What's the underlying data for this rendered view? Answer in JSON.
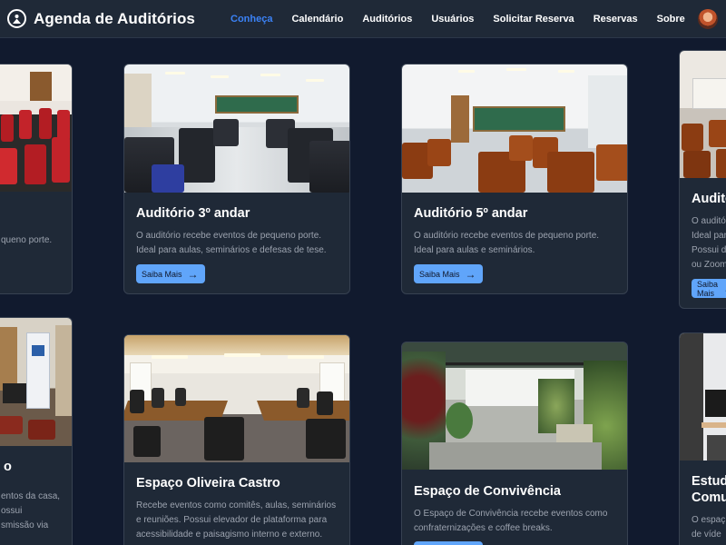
{
  "brand": {
    "title": "Agenda de Auditórios"
  },
  "nav": {
    "items": [
      "Conheça",
      "Calendário",
      "Auditórios",
      "Usuários",
      "Solicitar Reserva",
      "Reservas",
      "Sobre"
    ],
    "active": "Conheça"
  },
  "button_label": "Saiba Mais",
  "cards": [
    {
      "title": "",
      "lines": [
        "queno porte."
      ]
    },
    {
      "title": "Auditório 3º andar",
      "lines": [
        "O auditório recebe eventos de pequeno porte.",
        "Ideal para aulas, seminários e defesas de tese."
      ]
    },
    {
      "title": "Auditório 5º andar",
      "lines": [
        "O auditório recebe eventos de pequeno porte.",
        "Ideal para aulas e seminários."
      ]
    },
    {
      "title": "Auditó",
      "lines": [
        "O auditó",
        "Ideal par",
        "Possui d",
        "ou Zoom"
      ]
    },
    {
      "title": "o",
      "lines": [
        "entos da casa,",
        "ossui",
        "smissão via"
      ]
    },
    {
      "title": "Espaço Oliveira Castro",
      "lines": [
        "Recebe eventos como comitês, aulas, seminários",
        "e reuniões. Possui elevador de plataforma para",
        "acessibilidade e paisagismo interno e externo."
      ]
    },
    {
      "title": "Espaço de Convivência",
      "lines": [
        "O Espaço de Convivência recebe eventos como",
        "confraternizações e coffee breaks."
      ]
    },
    {
      "title_lines": [
        "Estud",
        "Comu"
      ],
      "lines": [
        "O espaç",
        "de víde"
      ]
    }
  ],
  "colors": {
    "background": "#111a2e",
    "card": "#1f2937",
    "accent": "#3b82f6",
    "button": "#60a5fa"
  }
}
